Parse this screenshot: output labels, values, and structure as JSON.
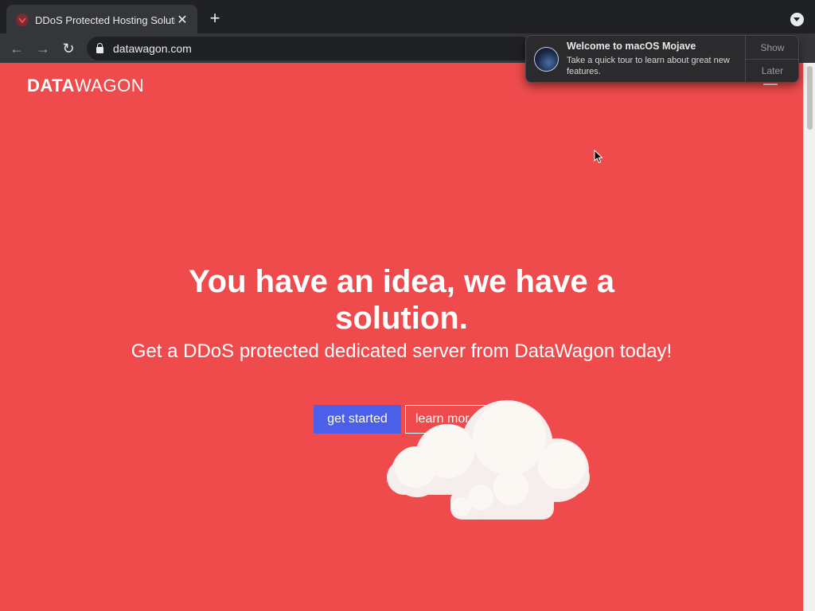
{
  "browser": {
    "tab_title": "DDoS Protected Hosting Soluti",
    "tab_close": "✕",
    "new_tab": "+",
    "url": "datawagon.com"
  },
  "page": {
    "logo_bold": "DATA",
    "logo_light": "WAGON",
    "headline": "You have an idea, we have a solution.",
    "subheadline": "Get a DDoS protected dedicated server from DataWagon today!",
    "primary_button": "get started",
    "secondary_button": "learn mor",
    "background_color": "#ef4b4d",
    "primary_button_color": "#4c5fe8"
  },
  "notification": {
    "title": "Welcome to macOS Mojave",
    "body": "Take a quick tour to learn about great new features.",
    "show_label": "Show",
    "later_label": "Later",
    "icon": "macos-mojave-icon"
  }
}
